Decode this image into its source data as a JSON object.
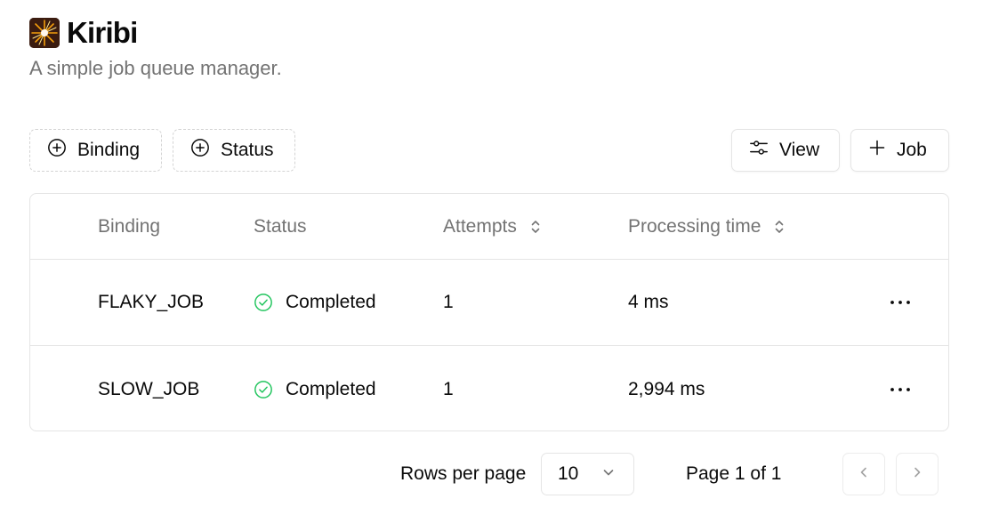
{
  "app": {
    "title": "Kiribi",
    "subtitle": "A simple job queue manager.",
    "logo_icon": "firework-icon"
  },
  "toolbar": {
    "filters": [
      {
        "label": "Binding",
        "icon": "plus-circle-icon"
      },
      {
        "label": "Status",
        "icon": "plus-circle-icon"
      }
    ],
    "view_label": "View",
    "view_icon": "sliders-icon",
    "add_job_label": "Job",
    "add_job_icon": "plus-icon"
  },
  "table": {
    "columns": [
      {
        "label": "Binding",
        "sortable": false
      },
      {
        "label": "Status",
        "sortable": false
      },
      {
        "label": "Attempts",
        "sortable": true
      },
      {
        "label": "Processing time",
        "sortable": true
      }
    ],
    "rows": [
      {
        "binding": "FLAKY_JOB",
        "status": "Completed",
        "attempts": "1",
        "processing_time": "4 ms"
      },
      {
        "binding": "SLOW_JOB",
        "status": "Completed",
        "attempts": "1",
        "processing_time": "2,994 ms"
      }
    ]
  },
  "pagination": {
    "rows_per_page_label": "Rows per page",
    "rows_per_page_value": "10",
    "page_info": "Page 1 of 1"
  },
  "colors": {
    "completed": "#22c55e",
    "muted_text": "#737373",
    "border": "#e5e5e5"
  }
}
